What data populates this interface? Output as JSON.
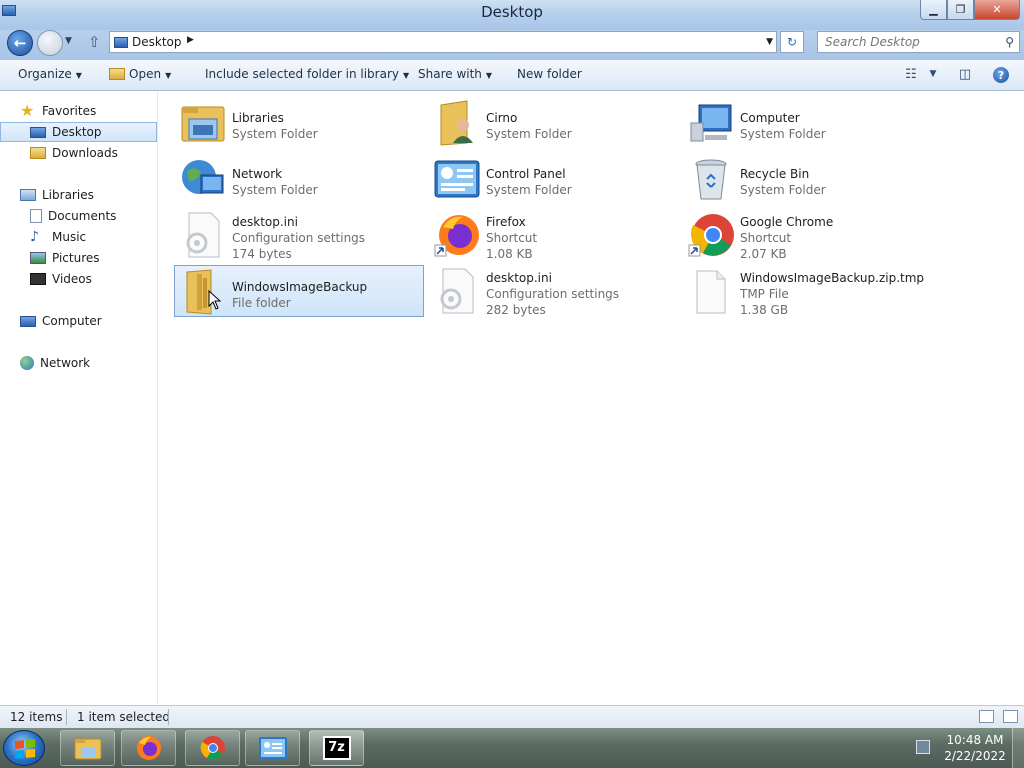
{
  "window": {
    "title": "Desktop"
  },
  "address": {
    "crumb": "Desktop"
  },
  "search": {
    "placeholder": "Search Desktop"
  },
  "toolbar": {
    "organize": "Organize",
    "open": "Open",
    "include": "Include selected folder in library",
    "share": "Share with",
    "new_folder": "New folder"
  },
  "nav": {
    "favorites": "Favorites",
    "desktop": "Desktop",
    "downloads": "Downloads",
    "libraries": "Libraries",
    "documents": "Documents",
    "music": "Music",
    "pictures": "Pictures",
    "videos": "Videos",
    "computer": "Computer",
    "network": "Network"
  },
  "items": [
    {
      "name": "Libraries",
      "type": "System Folder",
      "size": "",
      "icon": "libraries-icon"
    },
    {
      "name": "Cirno",
      "type": "System Folder",
      "size": "",
      "icon": "user-folder-icon"
    },
    {
      "name": "Computer",
      "type": "System Folder",
      "size": "",
      "icon": "computer-icon"
    },
    {
      "name": "Network",
      "type": "System Folder",
      "size": "",
      "icon": "network-icon"
    },
    {
      "name": "Control Panel",
      "type": "System Folder",
      "size": "",
      "icon": "control-panel-icon"
    },
    {
      "name": "Recycle Bin",
      "type": "System Folder",
      "size": "",
      "icon": "recycle-bin-icon"
    },
    {
      "name": "desktop.ini",
      "type": "Configuration settings",
      "size": "174 bytes",
      "icon": "settings-file-icon"
    },
    {
      "name": "Firefox",
      "type": "Shortcut",
      "size": "1.08 KB",
      "icon": "firefox-icon"
    },
    {
      "name": "Google Chrome",
      "type": "Shortcut",
      "size": "2.07 KB",
      "icon": "chrome-icon"
    },
    {
      "name": "WindowsImageBackup",
      "type": "File folder",
      "size": "",
      "icon": "folder-icon"
    },
    {
      "name": "desktop.ini",
      "type": "Configuration settings",
      "size": "282 bytes",
      "icon": "settings-file-icon"
    },
    {
      "name": "WindowsImageBackup.zip.tmp",
      "type": "TMP File",
      "size": "1.38 GB",
      "icon": "blank-file-icon"
    }
  ],
  "status": {
    "count": "12 items",
    "selected": "1 item selected"
  },
  "taskbar": {
    "apps": [
      "explorer-icon",
      "firefox-icon",
      "chrome-icon",
      "control-panel-icon",
      "7zip-icon"
    ],
    "sevenzip_label": "7z",
    "time": "10:48 AM",
    "date": "2/22/2022"
  }
}
